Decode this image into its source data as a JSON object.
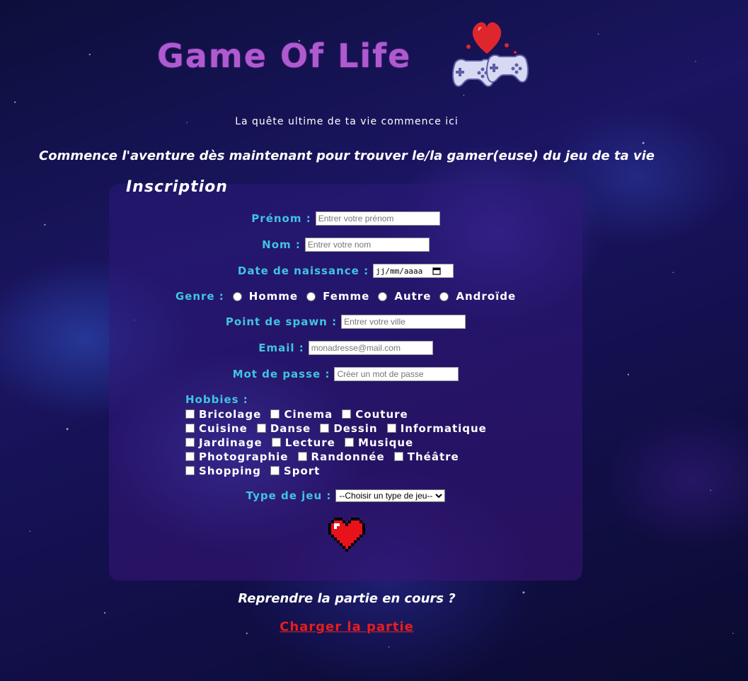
{
  "header": {
    "logo_text": "Game Of Life",
    "tagline": "La quête ultime de ta vie commence ici",
    "subtitle": "Commence l'aventure dès maintenant pour trouver le/la gamer(euse) du jeu de ta vie"
  },
  "form": {
    "title": "Inscription",
    "prenom": {
      "label": "Prénom :",
      "placeholder": "Entrer votre prénom"
    },
    "nom": {
      "label": "Nom :",
      "placeholder": "Entrer votre nom"
    },
    "naissance": {
      "label": "Date de naissance :",
      "placeholder": "jj/mm/aaaa"
    },
    "genre": {
      "label": "Genre :",
      "options": [
        "Homme",
        "Femme",
        "Autre",
        "Androïde"
      ]
    },
    "spawn": {
      "label": "Point de spawn :",
      "placeholder": "Entrer votre ville"
    },
    "email": {
      "label": "Email :",
      "placeholder": "monadresse@mail.com"
    },
    "password": {
      "label": "Mot de passe :",
      "placeholder": "Créer un mot de passe"
    },
    "hobbies": {
      "label": "Hobbies :",
      "lines": [
        [
          "Bricolage",
          "Cinema",
          "Couture"
        ],
        [
          "Cuisine",
          "Danse",
          "Dessin",
          "Informatique"
        ],
        [
          "Jardinage",
          "Lecture",
          "Musique"
        ],
        [
          "Photographie",
          "Randonnée",
          "Théâtre"
        ],
        [
          "Shopping",
          "Sport"
        ]
      ]
    },
    "type_jeu": {
      "label": "Type de jeu :",
      "selected": "--Choisir un type de jeu--"
    },
    "submit_icon": "pixel-heart-icon"
  },
  "footer": {
    "resume": "Reprendre la partie en cours ?",
    "load_link": "Charger la partie"
  },
  "colors": {
    "logo": "#b05ad0",
    "label": "#41c4e0",
    "link": "#e81d1d"
  }
}
